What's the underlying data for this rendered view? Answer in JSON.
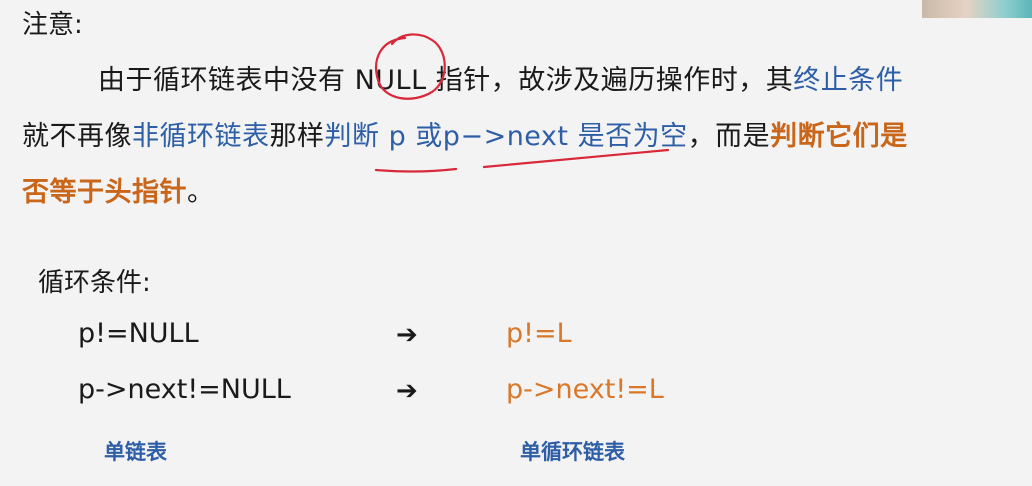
{
  "heading": "注意:",
  "paragraph": {
    "line1": {
      "prefix": "由于循环链表中没有 NULL 指针，故涉及遍历操作时，其",
      "highlight": "终止条件"
    },
    "line2": {
      "t1": "就不再像",
      "h1": "非循环链表",
      "t2": "那样",
      "h2": "判断 p 或p−>next 是否为空",
      "t3": "，而是",
      "h3": "判断它们是"
    },
    "line3": {
      "h1": "否等于头指针",
      "t1": "。"
    }
  },
  "conditions_title": "循环条件:",
  "rows": [
    {
      "left": "p!=NULL",
      "arrow": "➔",
      "right": "p!=L"
    },
    {
      "left": "p->next!=NULL",
      "arrow": "➔",
      "right": "p->next!=L"
    }
  ],
  "captions": {
    "left": "单链表",
    "right": "单循环链表"
  },
  "colors": {
    "background": "#f3f3f3",
    "text": "#1a1a1a",
    "blue_highlight": "#2e5fa6",
    "orange_highlight": "#c9661a",
    "orange_code": "#d9782a",
    "annotation_red": "#d8283a"
  }
}
